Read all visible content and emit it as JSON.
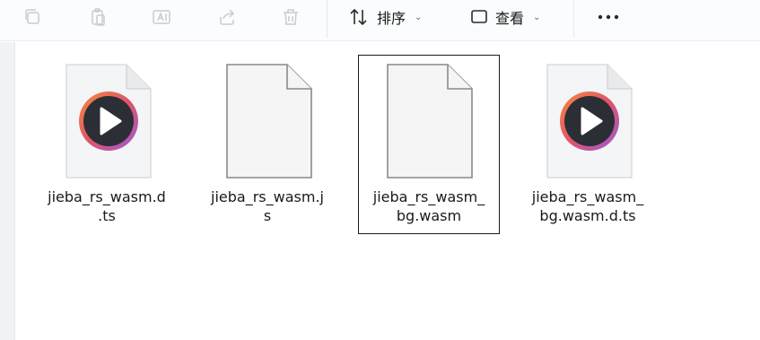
{
  "toolbar": {
    "buttons": [
      {
        "name": "copy-icon"
      },
      {
        "name": "paste-icon"
      },
      {
        "name": "rename-icon"
      },
      {
        "name": "share-icon"
      },
      {
        "name": "delete-icon"
      }
    ],
    "sort_label": "排序",
    "view_label": "查看",
    "more_icon": "more-icon"
  },
  "files": [
    {
      "name": "jieba_rs_wasm.d.ts",
      "label": "jieba_rs_wasm.d\n.ts",
      "icon": "media-player-file-icon"
    },
    {
      "name": "jieba_rs_wasm.js",
      "label": "jieba_rs_wasm.j\ns",
      "icon": "generic-file-icon"
    },
    {
      "name": "jieba_rs_wasm_bg.wasm",
      "label": "jieba_rs_wasm_\nbg.wasm",
      "icon": "generic-file-icon",
      "selected": true
    },
    {
      "name": "jieba_rs_wasm_bg.wasm.d.ts",
      "label": "jieba_rs_wasm_\nbg.wasm.d.ts",
      "icon": "media-player-file-icon"
    }
  ],
  "colors": {
    "toolbar_bg": "#fbfcfd",
    "icon_disabled": "#c7ccd1",
    "play_gradient_start": "#f58a3c",
    "play_gradient_end": "#9a5bd6"
  }
}
